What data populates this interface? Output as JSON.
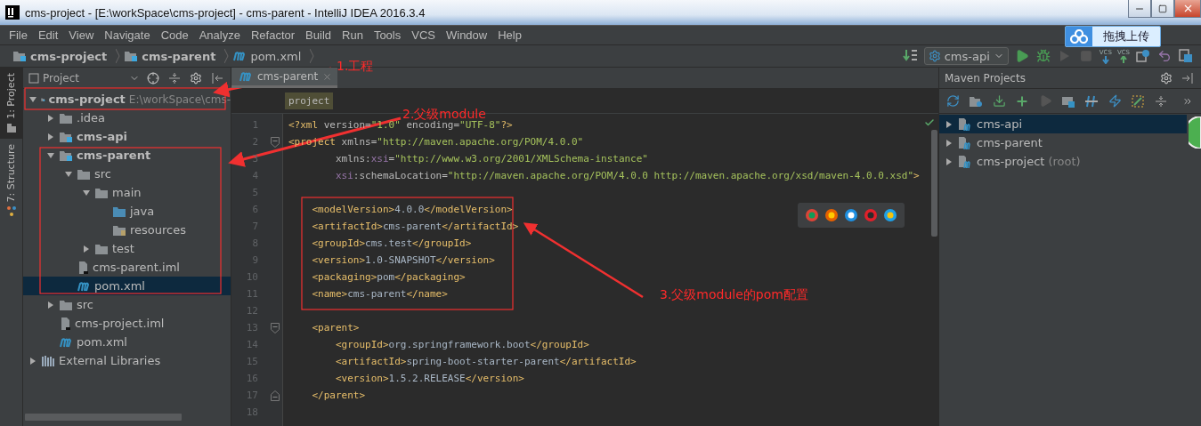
{
  "window": {
    "title": "cms-project - [E:\\workSpace\\cms-project] - cms-parent - IntelliJ IDEA 2016.3.4"
  },
  "menu": [
    "File",
    "Edit",
    "View",
    "Navigate",
    "Code",
    "Analyze",
    "Refactor",
    "Build",
    "Run",
    "Tools",
    "VCS",
    "Window",
    "Help"
  ],
  "upload_button": {
    "label": "拖拽上传"
  },
  "breadcrumbs": [
    {
      "label": "cms-project",
      "kind": "module"
    },
    {
      "label": "cms-parent",
      "kind": "module"
    },
    {
      "label": "pom.xml",
      "kind": "maven"
    }
  ],
  "run_config": {
    "label": "cms-api"
  },
  "vcs_buttons": [
    {
      "label": "VCS",
      "kind": "update"
    },
    {
      "label": "VCS",
      "kind": "commit"
    }
  ],
  "side_tabs": [
    {
      "label": "1: Project",
      "selected": true
    },
    {
      "label": "7: Structure",
      "selected": false
    }
  ],
  "project_panel": {
    "title": "Project",
    "tree": [
      {
        "label": "cms-project",
        "hint": "E:\\workSpace\\cms-",
        "kind": "module",
        "expanded": true,
        "selected": false,
        "children": [
          {
            "label": ".idea",
            "kind": "folder",
            "expanded": false,
            "selected": false
          },
          {
            "label": "cms-api",
            "kind": "module",
            "expanded": false,
            "selected": false
          },
          {
            "label": "cms-parent",
            "kind": "module",
            "expanded": true,
            "selected": false,
            "children": [
              {
                "label": "src",
                "kind": "folder",
                "expanded": true,
                "selected": false,
                "children": [
                  {
                    "label": "main",
                    "kind": "folder",
                    "expanded": true,
                    "selected": false,
                    "children": [
                      {
                        "label": "java",
                        "kind": "source",
                        "selected": false
                      },
                      {
                        "label": "resources",
                        "kind": "resources",
                        "selected": false
                      }
                    ]
                  },
                  {
                    "label": "test",
                    "kind": "folder",
                    "expanded": false,
                    "selected": false
                  }
                ]
              },
              {
                "label": "cms-parent.iml",
                "kind": "iml",
                "selected": false
              },
              {
                "label": "pom.xml",
                "kind": "maven",
                "selected": true
              }
            ]
          },
          {
            "label": "src",
            "kind": "folder",
            "expanded": false,
            "selected": false
          },
          {
            "label": "cms-project.iml",
            "kind": "iml",
            "selected": false
          },
          {
            "label": "pom.xml",
            "kind": "maven",
            "selected": false
          }
        ]
      },
      {
        "label": "External Libraries",
        "kind": "library",
        "expanded": false,
        "selected": false
      }
    ]
  },
  "editor": {
    "tabs": [
      {
        "label": "cms-parent",
        "selected": true
      }
    ],
    "breadcrumb": "project",
    "lines": [
      {
        "number": "1",
        "segments": [
          {
            "kind": "tag",
            "text": "<?xml "
          },
          {
            "kind": "attr",
            "text": "version="
          },
          {
            "kind": "value",
            "text": "\"1.0\""
          },
          {
            "kind": "attr",
            "text": " encoding="
          },
          {
            "kind": "value",
            "text": "\"UTF-8\""
          },
          {
            "kind": "tag",
            "text": "?>"
          }
        ]
      },
      {
        "number": "2",
        "fold_open": true,
        "segments": [
          {
            "kind": "tag",
            "text": "<project "
          },
          {
            "kind": "attr",
            "text": "xmlns="
          },
          {
            "kind": "value",
            "text": "\"http://maven.apache.org/POM/4.0.0\""
          }
        ]
      },
      {
        "number": "3",
        "segments": [
          {
            "kind": "attr",
            "text": "        xmlns:"
          },
          {
            "kind": "ns",
            "text": "xsi"
          },
          {
            "kind": "attr",
            "text": "="
          },
          {
            "kind": "value",
            "text": "\"http://www.w3.org/2001/XMLSchema-instance\""
          }
        ]
      },
      {
        "number": "4",
        "segments": [
          {
            "kind": "ns",
            "text": "        xsi"
          },
          {
            "kind": "attr",
            "text": ":schemaLocation="
          },
          {
            "kind": "value",
            "text": "\"http://maven.apache.org/POM/4.0.0 http://maven.apache.org/xsd/maven-4.0.0.xsd\""
          },
          {
            "kind": "tag",
            "text": ">"
          }
        ]
      },
      {
        "number": "5"
      },
      {
        "number": "6",
        "segments": [
          {
            "kind": "tag",
            "text": "    <modelVersion>"
          },
          {
            "kind": "text",
            "text": "4.0.0"
          },
          {
            "kind": "tag",
            "text": "</modelVersion>"
          }
        ]
      },
      {
        "number": "7",
        "segments": [
          {
            "kind": "tag",
            "text": "    <artifactId>"
          },
          {
            "kind": "text",
            "text": "cms-parent"
          },
          {
            "kind": "tag",
            "text": "</artifactId>"
          }
        ]
      },
      {
        "number": "8",
        "segments": [
          {
            "kind": "tag",
            "text": "    <groupId>"
          },
          {
            "kind": "text",
            "text": "cms.test"
          },
          {
            "kind": "tag",
            "text": "</groupId>"
          }
        ]
      },
      {
        "number": "9",
        "segments": [
          {
            "kind": "tag",
            "text": "    <version>"
          },
          {
            "kind": "text",
            "text": "1.0-SNAPSHOT"
          },
          {
            "kind": "tag",
            "text": "</version>"
          }
        ]
      },
      {
        "number": "10",
        "segments": [
          {
            "kind": "tag",
            "text": "    <packaging>"
          },
          {
            "kind": "text",
            "text": "pom"
          },
          {
            "kind": "tag",
            "text": "</packaging>"
          }
        ]
      },
      {
        "number": "11",
        "segments": [
          {
            "kind": "tag",
            "text": "    <name>"
          },
          {
            "kind": "text",
            "text": "cms-parent"
          },
          {
            "kind": "tag",
            "text": "</name>"
          }
        ]
      },
      {
        "number": "12"
      },
      {
        "number": "13",
        "fold_open": true,
        "segments": [
          {
            "kind": "tag",
            "text": "    <parent>"
          }
        ]
      },
      {
        "number": "14",
        "segments": [
          {
            "kind": "tag",
            "text": "        <groupId>"
          },
          {
            "kind": "text",
            "text": "org.springframework.boot"
          },
          {
            "kind": "tag",
            "text": "</groupId>"
          }
        ]
      },
      {
        "number": "15",
        "segments": [
          {
            "kind": "tag",
            "text": "        <artifactId>"
          },
          {
            "kind": "text",
            "text": "spring-boot-starter-parent"
          },
          {
            "kind": "tag",
            "text": "</artifactId>"
          }
        ]
      },
      {
        "number": "16",
        "segments": [
          {
            "kind": "tag",
            "text": "        <version>"
          },
          {
            "kind": "text",
            "text": "1.5.2.RELEASE"
          },
          {
            "kind": "tag",
            "text": "</version>"
          }
        ]
      },
      {
        "number": "17",
        "fold_close": true,
        "segments": [
          {
            "kind": "tag",
            "text": "    </parent>"
          }
        ]
      },
      {
        "number": "18"
      }
    ]
  },
  "maven_panel": {
    "title": "Maven Projects",
    "tree": [
      {
        "label": "cms-api",
        "expanded": false,
        "selected": true
      },
      {
        "label": "cms-parent",
        "expanded": false,
        "selected": false
      },
      {
        "label": "cms-project",
        "suffix": "(root)",
        "expanded": false,
        "selected": false
      }
    ]
  },
  "annotations": [
    {
      "label": "1.工程"
    },
    {
      "label": "2.父级module"
    },
    {
      "label": "3.父级module的pom配置"
    }
  ]
}
